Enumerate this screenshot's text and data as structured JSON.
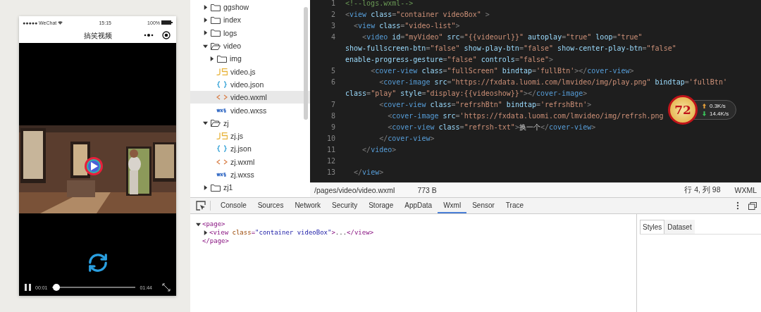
{
  "phone": {
    "status_bar": {
      "carrier": "●●●●● WeChat",
      "time": "15:15",
      "battery": "100%"
    },
    "nav_title": "搞笑视频",
    "video": {
      "current_time": "00:01",
      "duration": "01:44",
      "level": 0.01,
      "playing": true
    }
  },
  "file_tree": [
    {
      "name": "ggshow",
      "kind": "folder",
      "expanded": false,
      "selected": false
    },
    {
      "name": "index",
      "kind": "folder",
      "expanded": false,
      "selected": false
    },
    {
      "name": "logs",
      "kind": "folder",
      "expanded": false,
      "selected": false
    },
    {
      "name": "video",
      "kind": "folder",
      "expanded": true,
      "selected": false,
      "children": [
        {
          "name": "img",
          "kind": "folder",
          "expanded": false,
          "selected": false
        },
        {
          "name": "video.js",
          "kind": "js",
          "selected": false
        },
        {
          "name": "video.json",
          "kind": "json",
          "selected": false
        },
        {
          "name": "video.wxml",
          "kind": "wxml",
          "selected": true
        },
        {
          "name": "video.wxss",
          "kind": "wxss",
          "selected": false
        }
      ]
    },
    {
      "name": "zj",
      "kind": "folder",
      "expanded": true,
      "selected": false,
      "children": [
        {
          "name": "zj.js",
          "kind": "js",
          "selected": false
        },
        {
          "name": "zj.json",
          "kind": "json",
          "selected": false
        },
        {
          "name": "zj.wxml",
          "kind": "wxml",
          "selected": false
        },
        {
          "name": "zj.wxss",
          "kind": "wxss",
          "selected": false
        }
      ]
    },
    {
      "name": "zj1",
      "kind": "folder",
      "expanded": false,
      "selected": false
    }
  ],
  "editor": {
    "lines": [
      {
        "number": "1",
        "parts": [
          "<!--logs.wxml-->"
        ]
      },
      {
        "number": "2",
        "parts": [
          "<view class=\"container videoBox\" >"
        ]
      },
      {
        "number": "3",
        "parts": [
          "  <view class=\"video-list\">"
        ]
      },
      {
        "number": "4",
        "parts": [
          "    <video id=\"myVideo\" src=\"{{videourl}}\" autoplay=\"true\" loop=\"true\"",
          "show-fullscreen-btn=\"false\" show-play-btn=\"false\" show-center-play-btn=\"false\"",
          "enable-progress-gesture=\"false\" controls=\"false\">"
        ]
      },
      {
        "number": "5",
        "parts": [
          "      <cover-view class=\"fullScreen\" bindtap='fullBtn'></cover-view>"
        ]
      },
      {
        "number": "6",
        "parts": [
          "        <cover-image src=\"https://fxdata.luomi.com/lmvideo/img/play.png\" bindtap='fullBtn'",
          "class=\"play\" style=\"display:{{videoshow}}\"></cover-image>"
        ]
      },
      {
        "number": "7",
        "parts": [
          "        <cover-view class=\"refrshBtn\" bindtap='refrshBtn'>"
        ]
      },
      {
        "number": "8",
        "parts": [
          "          <cover-image src='https://fxdata.luomi.com/lmvideo/img/refrsh.png"
        ]
      },
      {
        "number": "9",
        "parts": [
          "          <cover-view class=\"refrsh-txt\">换一个</cover-view>"
        ]
      },
      {
        "number": "10",
        "parts": [
          "        </cover-view>"
        ]
      },
      {
        "number": "11",
        "parts": [
          "    </video>"
        ]
      },
      {
        "number": "12"
      },
      {
        "number": "13",
        "parts": [
          "  </view>"
        ]
      }
    ],
    "speed_widget": {
      "percent": "72",
      "upload": "0.3K/s",
      "download": "14.4K/s"
    }
  },
  "status_bar": {
    "path": "/pages/video/video.wxml",
    "size": "773 B",
    "position": "行 4, 列 98",
    "language": "WXML"
  },
  "devtools": {
    "tabs": [
      {
        "label": "Console",
        "selected": false
      },
      {
        "label": "Sources",
        "selected": false
      },
      {
        "label": "Network",
        "selected": false
      },
      {
        "label": "Security",
        "selected": false
      },
      {
        "label": "Storage",
        "selected": false
      },
      {
        "label": "AppData",
        "selected": false
      },
      {
        "label": "Wxml",
        "selected": true
      },
      {
        "label": "Sensor",
        "selected": false
      },
      {
        "label": "Trace",
        "selected": false
      }
    ],
    "dom_tree": [
      {
        "open": "<page>",
        "expanded": true,
        "close": "</page>",
        "children": [
          {
            "text": "<view class=\"container videoBox\">...</view>",
            "expanded": false
          }
        ]
      }
    ],
    "side_tabs": [
      {
        "label": "Styles",
        "selected": true
      },
      {
        "label": "Dataset",
        "selected": false
      }
    ]
  }
}
